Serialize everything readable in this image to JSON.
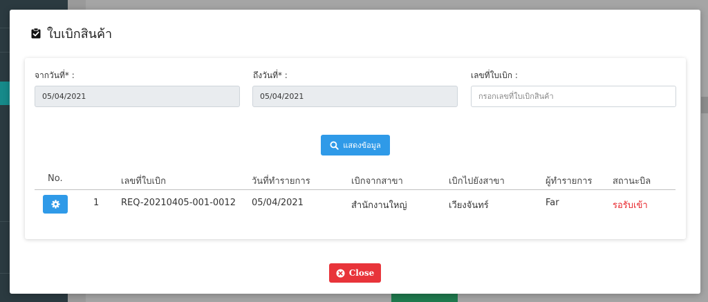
{
  "modal": {
    "title": "ใบเบิกสินค้า",
    "close_label": "Close"
  },
  "filters": {
    "from_date": {
      "label": "จากวันที่* :",
      "value": "05/04/2021"
    },
    "to_date": {
      "label": "ถึงวันที่* :",
      "value": "05/04/2021"
    },
    "req_no": {
      "label": "เลขที่ใบเบิก :",
      "placeholder": "กรอกเลขที่ใบเบิกสินค้า"
    },
    "show_button": "แสดงข้อมูล"
  },
  "table": {
    "headers": [
      "No.",
      "เลขที่ใบเบิก",
      "วันที่ทำรายการ",
      "เบิกจากสาขา",
      "เบิกไปยังสาขา",
      "ผู้ทำรายการ",
      "สถานะบิล"
    ],
    "rows": [
      {
        "no": "1",
        "req_no": "REQ-20210405-001-0012",
        "date": "05/04/2021",
        "from_branch": "สำนักงานใหญ่",
        "to_branch": "เวียงจันทร์",
        "user": "Far",
        "status": "รอรับเข้า"
      }
    ]
  },
  "colors": {
    "primary": "#2f9ae8",
    "danger": "#e8343a",
    "status_pending": "#e8242a"
  },
  "icons": {
    "title": "clipboard-check-icon",
    "show": "search-icon",
    "row_action": "gear-icon",
    "close": "x-circle-icon"
  }
}
